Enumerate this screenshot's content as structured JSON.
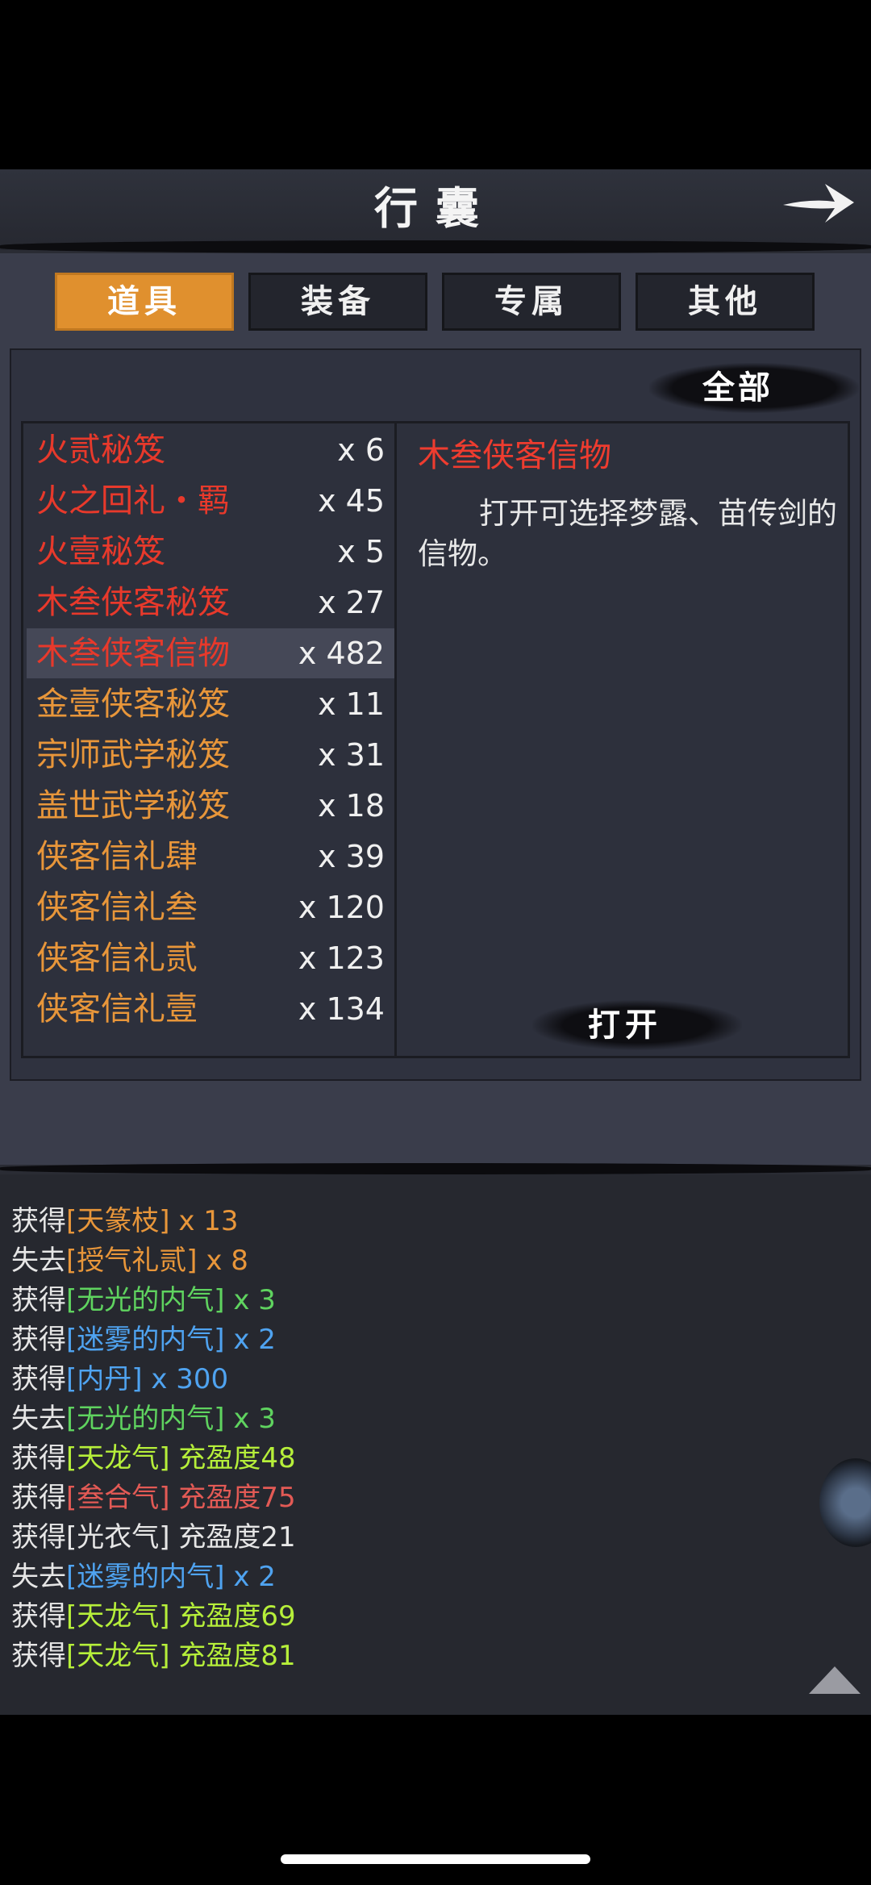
{
  "header": {
    "title": "行囊"
  },
  "tabs": [
    {
      "label": "道具",
      "active": true
    },
    {
      "label": "装备",
      "active": false
    },
    {
      "label": "专属",
      "active": false
    },
    {
      "label": "其他",
      "active": false
    }
  ],
  "filter": {
    "label": "全部"
  },
  "items": [
    {
      "name": "火贰秘笈",
      "count": "x 6",
      "color": "#e8392b"
    },
    {
      "name": "火之回礼・羁",
      "count": "x 45",
      "color": "#e8392b"
    },
    {
      "name": "火壹秘笈",
      "count": "x 5",
      "color": "#e8392b"
    },
    {
      "name": "木叁侠客秘笈",
      "count": "x 27",
      "color": "#e8392b"
    },
    {
      "name": "木叁侠客信物",
      "count": "x 482",
      "color": "#e8392b",
      "selected": true
    },
    {
      "name": "金壹侠客秘笈",
      "count": "x 11",
      "color": "#e8963a"
    },
    {
      "name": "宗师武学秘笈",
      "count": "x 31",
      "color": "#e8963a"
    },
    {
      "name": "盖世武学秘笈",
      "count": "x 18",
      "color": "#e8963a"
    },
    {
      "name": "侠客信礼肆",
      "count": "x 39",
      "color": "#e8963a"
    },
    {
      "name": "侠客信礼叁",
      "count": "x 120",
      "color": "#e8963a"
    },
    {
      "name": "侠客信礼贰",
      "count": "x 123",
      "color": "#e8963a"
    },
    {
      "name": "侠客信礼壹",
      "count": "x 134",
      "color": "#e8963a"
    }
  ],
  "detail": {
    "title": "木叁侠客信物",
    "description": "打开可选择梦露、苗传剑的信物。",
    "open_label": "打开"
  },
  "log": [
    {
      "prefix": "获得",
      "item": "[天篆枝] x 13",
      "color": "#e8963a"
    },
    {
      "prefix": "失去",
      "item": "[授气礼贰] x 8",
      "color": "#e8963a"
    },
    {
      "prefix": "获得",
      "item": "[无光的内气] x 3",
      "color": "#5fd35f"
    },
    {
      "prefix": "获得",
      "item": "[迷雾的内气] x 2",
      "color": "#4fa3f0"
    },
    {
      "prefix": "获得",
      "item": "[内丹] x 300",
      "color": "#4fa3f0"
    },
    {
      "prefix": "失去",
      "item": "[无光的内气] x 3",
      "color": "#5fd35f"
    },
    {
      "prefix": "获得",
      "item": "[天龙气] 充盈度48",
      "color": "#b6ef3a"
    },
    {
      "prefix": "获得",
      "item": "[叁合气] 充盈度75",
      "color": "#e35a55"
    },
    {
      "prefix": "获得",
      "item": "[光衣气] 充盈度21",
      "color": "#e6e6e6"
    },
    {
      "prefix": "失去",
      "item": "[迷雾的内气] x 2",
      "color": "#4fa3f0"
    },
    {
      "prefix": "获得",
      "item": "[天龙气] 充盈度69",
      "color": "#b6ef3a"
    },
    {
      "prefix": "获得",
      "item": "[天龙气] 充盈度81",
      "color": "#b6ef3a"
    }
  ]
}
